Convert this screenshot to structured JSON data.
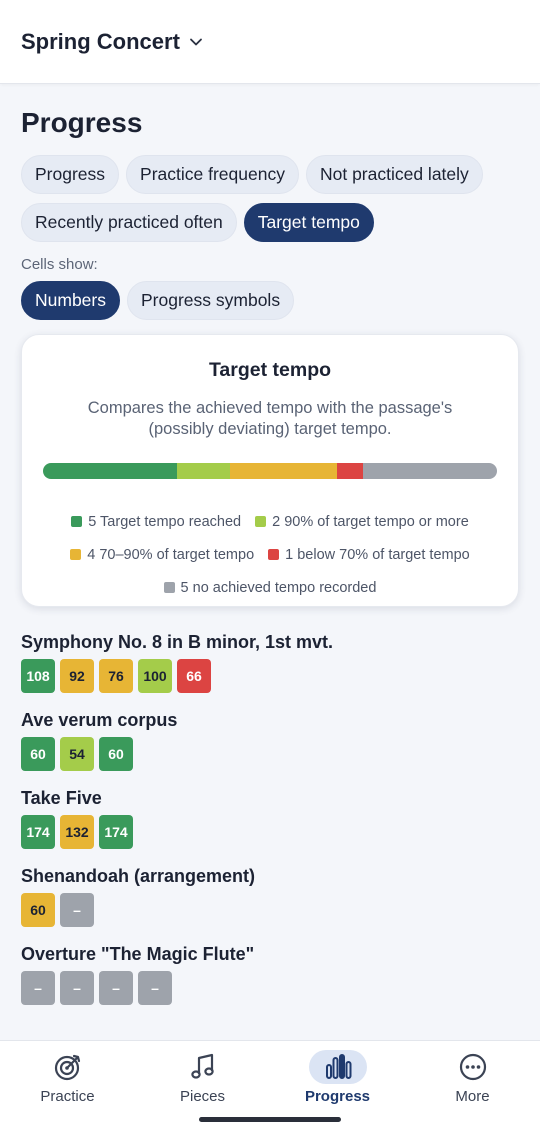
{
  "header": {
    "project": "Spring Concert"
  },
  "page": {
    "title": "Progress"
  },
  "views": [
    {
      "label": "Progress",
      "active": false
    },
    {
      "label": "Practice frequency",
      "active": false
    },
    {
      "label": "Not practiced lately",
      "active": false
    },
    {
      "label": "Recently practiced often",
      "active": false
    },
    {
      "label": "Target tempo",
      "active": true
    }
  ],
  "cells_show": {
    "label": "Cells show:",
    "options": [
      {
        "label": "Numbers",
        "active": true
      },
      {
        "label": "Progress symbols",
        "active": false
      }
    ]
  },
  "legend_card": {
    "title": "Target tempo",
    "description": "Compares the achieved tempo with the passage's (possibly deviating) target tempo.",
    "items": [
      {
        "key": "reached",
        "text": "5 Target tempo reached",
        "count": 5,
        "color": "#3a9a5b"
      },
      {
        "key": "ninety",
        "text": "2 90% of target tempo or more",
        "count": 2,
        "color": "#a4cc4a"
      },
      {
        "key": "seventy",
        "text": "4 70–90% of target tempo",
        "count": 4,
        "color": "#e7b535"
      },
      {
        "key": "below",
        "text": "1 below 70% of target tempo",
        "count": 1,
        "color": "#dc4442"
      },
      {
        "key": "none",
        "text": "5 no achieved tempo recorded",
        "count": 5,
        "color": "#9ea3ab"
      }
    ]
  },
  "pieces": [
    {
      "title": "Symphony No. 8 in B minor, 1st mvt.",
      "cells": [
        {
          "text": "108",
          "status": "reached"
        },
        {
          "text": "92",
          "status": "seventy"
        },
        {
          "text": "76",
          "status": "seventy"
        },
        {
          "text": "100",
          "status": "ninety"
        },
        {
          "text": "66",
          "status": "below"
        }
      ]
    },
    {
      "title": "Ave verum corpus",
      "cells": [
        {
          "text": "60",
          "status": "reached"
        },
        {
          "text": "54",
          "status": "ninety"
        },
        {
          "text": "60",
          "status": "reached"
        }
      ]
    },
    {
      "title": "Take Five",
      "cells": [
        {
          "text": "174",
          "status": "reached"
        },
        {
          "text": "132",
          "status": "seventy"
        },
        {
          "text": "174",
          "status": "reached"
        }
      ]
    },
    {
      "title": "Shenandoah (arrangement)",
      "cells": [
        {
          "text": "60",
          "status": "seventy"
        },
        {
          "text": "–",
          "status": "none"
        }
      ]
    },
    {
      "title": "Overture \"The Magic Flute\"",
      "cells": [
        {
          "text": "–",
          "status": "none"
        },
        {
          "text": "–",
          "status": "none"
        },
        {
          "text": "–",
          "status": "none"
        },
        {
          "text": "–",
          "status": "none"
        }
      ]
    }
  ],
  "status_style": {
    "reached": {
      "bg": "#3a9a5b",
      "fg": "#ffffff"
    },
    "ninety": {
      "bg": "#a4cc4a",
      "fg": "#1c2233"
    },
    "seventy": {
      "bg": "#e7b535",
      "fg": "#1c2233"
    },
    "below": {
      "bg": "#dc4442",
      "fg": "#ffffff"
    },
    "none": {
      "bg": "#9ea3ab",
      "fg": "#ffffff"
    }
  },
  "bottom_nav": [
    {
      "label": "Practice",
      "icon": "target-icon",
      "active": false
    },
    {
      "label": "Pieces",
      "icon": "music-note-icon",
      "active": false
    },
    {
      "label": "Progress",
      "icon": "bar-chart-icon",
      "active": true
    },
    {
      "label": "More",
      "icon": "more-icon",
      "active": false
    }
  ]
}
